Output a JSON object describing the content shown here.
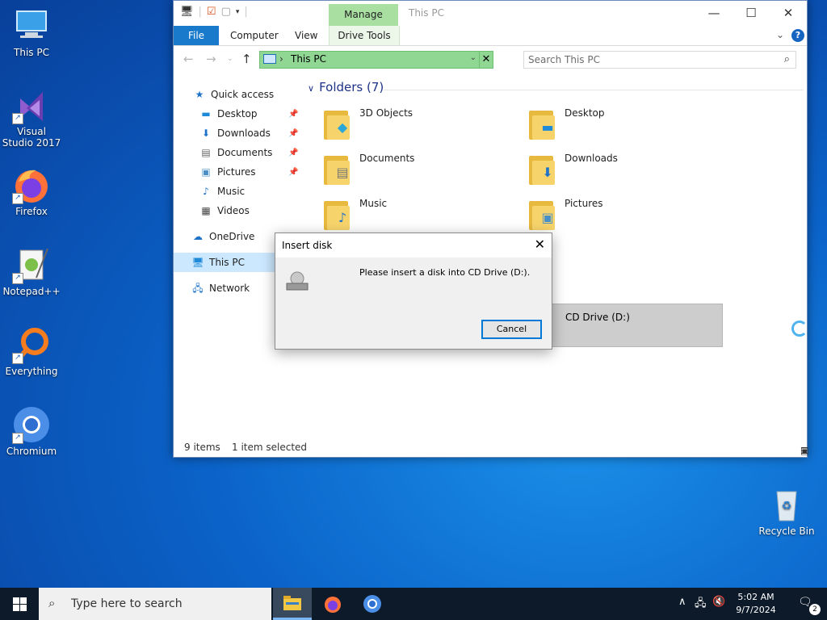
{
  "desktop": {
    "icons": [
      {
        "label": "This PC"
      },
      {
        "label": "Visual Studio 2017"
      },
      {
        "label": "Firefox"
      },
      {
        "label": "Notepad++"
      },
      {
        "label": "Everything"
      },
      {
        "label": "Chromium"
      },
      {
        "label": "Recycle Bin"
      }
    ]
  },
  "explorer": {
    "title": "This PC",
    "manage_tab": "Manage",
    "tabs": {
      "file": "File",
      "computer": "Computer",
      "view": "View",
      "drive_tools": "Drive Tools"
    },
    "address": "This PC",
    "search_placeholder": "Search This PC",
    "nav": {
      "quick_access": "Quick access",
      "desktop": "Desktop",
      "downloads": "Downloads",
      "documents": "Documents",
      "pictures": "Pictures",
      "music": "Music",
      "videos": "Videos",
      "onedrive": "OneDrive",
      "this_pc": "This PC",
      "network": "Network"
    },
    "folders_header": "Folders (7)",
    "folders": [
      {
        "name": "3D Objects"
      },
      {
        "name": "Desktop"
      },
      {
        "name": "Documents"
      },
      {
        "name": "Downloads"
      },
      {
        "name": "Music"
      },
      {
        "name": "Pictures"
      }
    ],
    "cd_drive": "CD Drive (D:)",
    "status": {
      "items": "9 items",
      "selected": "1 item selected"
    }
  },
  "dialog": {
    "title": "Insert disk",
    "message": "Please insert a disk into CD Drive (D:).",
    "cancel": "Cancel"
  },
  "taskbar": {
    "search_placeholder": "Type here to search",
    "time": "5:02 AM",
    "date": "9/7/2024",
    "notification_count": "2"
  }
}
